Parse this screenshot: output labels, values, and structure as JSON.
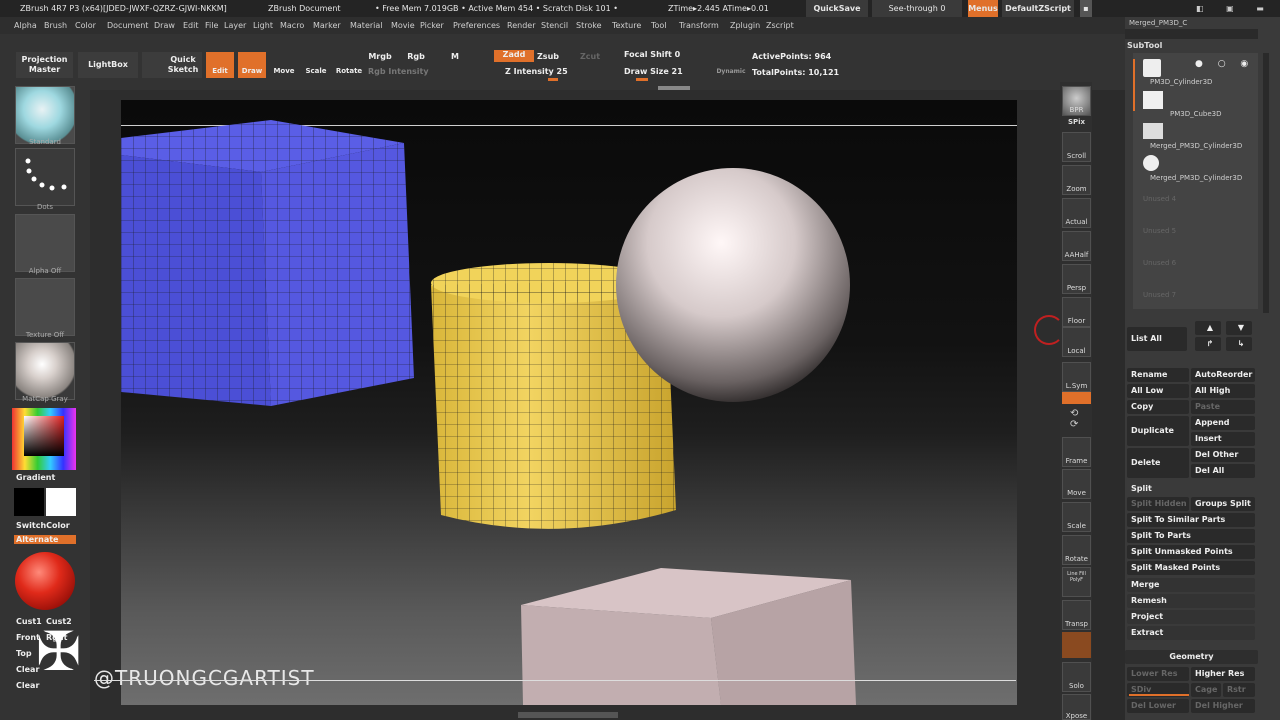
{
  "titlebar": {
    "app": "ZBrush 4R7 P3 (x64)[JDED-JWXF-QZRZ-GJWI-NKKM]",
    "doc": "ZBrush Document",
    "free_mem": "• Free Mem 7.019GB • Active Mem 454 • Scratch Disk 101 •",
    "ztime": "ZTime▸2.445 ATime▸0.01",
    "quicksave": "QuickSave",
    "see_through": "See-through  0",
    "menus": "Menus",
    "zscript": "DefaultZScript"
  },
  "menubar": [
    "Alpha",
    "Brush",
    "Color",
    "Document",
    "Draw",
    "Edit",
    "File",
    "Layer",
    "Light",
    "Macro",
    "Marker",
    "Material",
    "Movie",
    "Picker",
    "Preferences",
    "Render",
    "Stencil",
    "Stroke",
    "Texture",
    "Tool",
    "Transform",
    "Zplugin",
    "Zscript"
  ],
  "toolbar": {
    "projection_master": "Projection Master",
    "lightbox": "LightBox",
    "quick_sketch": "Quick Sketch",
    "edit": "Edit",
    "draw": "Draw",
    "move": "Move",
    "scale": "Scale",
    "rotate": "Rotate",
    "mrgb": "Mrgb",
    "rgb": "Rgb",
    "m": "M",
    "rgb_intensity": "Rgb  Intensity",
    "zadd": "Zadd",
    "zsub": "Zsub",
    "zcut": "Zcut",
    "z_intensity": "Z Intensity 25",
    "focal_shift": "Focal Shift 0",
    "draw_size": "Draw Size 21",
    "dynamic": "Dynamic",
    "active_points": "ActivePoints: 964",
    "total_points": "TotalPoints: 10,121"
  },
  "left": {
    "standard": "Standard",
    "dots": "Dots",
    "alpha_off": "Alpha Off",
    "texture_off": "Texture Off",
    "matcap": "MatCap Gray",
    "gradient": "Gradient",
    "switch_color": "SwitchColor",
    "alternate": "Alternate",
    "cust1": "Cust1",
    "cust2": "Cust2",
    "front": "Front",
    "right": "Rght",
    "top": "Top",
    "clear1": "Clear",
    "clear2": "Clear"
  },
  "watermark": "@TRUONGCGARTIST",
  "shelf": [
    "BPR",
    "SPix",
    "Scroll",
    "Zoom",
    "Actual",
    "AAHalf",
    "Persp",
    "Floor",
    "Local",
    "L.Sym",
    "Frame",
    "Move",
    "Scale",
    "Rotate",
    "Line Fill PolyF",
    "Transp",
    "Solo",
    "Xpose"
  ],
  "panel": {
    "merged_top": "Merged_PM3D_C",
    "subtool_header": "SubTool",
    "subtools": [
      "PM3D_Cylinder3D",
      "PM3D_Cube3D",
      "Merged_PM3D_Cylinder3D",
      "Merged_PM3D_Cylinder3D"
    ],
    "unused": [
      "Unused 4",
      "Unused 5",
      "Unused 6",
      "Unused 7"
    ],
    "list_all": "List All",
    "rename": "Rename",
    "autoreorder": "AutoReorder",
    "all_low": "All Low",
    "all_high": "All High",
    "copy": "Copy",
    "paste": "Paste",
    "duplicate": "Duplicate",
    "append": "Append",
    "insert": "Insert",
    "delete": "Delete",
    "del_other": "Del Other",
    "del_all": "Del All",
    "split": "Split",
    "split_hidden": "Split Hidden",
    "groups_split": "Groups Split",
    "split_similar": "Split To Similar Parts",
    "split_parts": "Split To Parts",
    "split_unmasked": "Split Unmasked Points",
    "split_masked": "Split Masked Points",
    "merge": "Merge",
    "remesh": "Remesh",
    "project": "Project",
    "extract": "Extract",
    "geometry": "Geometry",
    "lower_res": "Lower Res",
    "higher_res": "Higher Res",
    "sdiv": "SDiv",
    "cage": "Cage",
    "rstr": "Rstr",
    "del_lower": "Del Lower",
    "del_higher": "Del Higher"
  }
}
